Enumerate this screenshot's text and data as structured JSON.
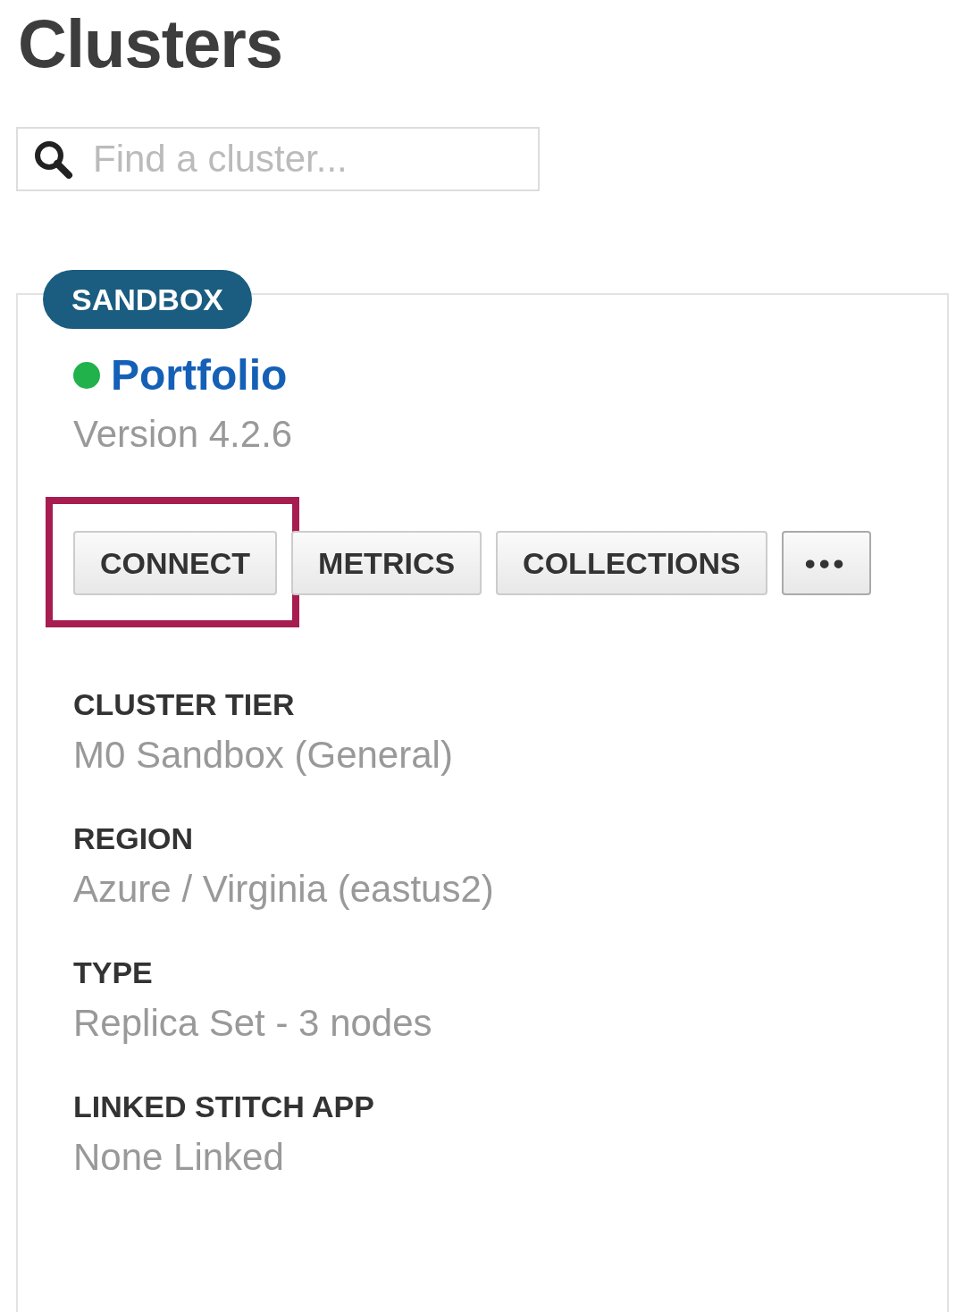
{
  "title": "Clusters",
  "search": {
    "placeholder": "Find a cluster..."
  },
  "cluster": {
    "badge": "SANDBOX",
    "online": true,
    "name": "Portfolio",
    "version": "Version 4.2.6",
    "buttons": [
      {
        "kind": "text",
        "label": "CONNECT",
        "highlighted": true
      },
      {
        "kind": "text",
        "label": "METRICS",
        "highlighted": false
      },
      {
        "kind": "text",
        "label": "COLLECTIONS",
        "highlighted": false
      },
      {
        "kind": "more",
        "label": "•••",
        "highlighted": false
      }
    ],
    "details": [
      {
        "label": "CLUSTER TIER",
        "value": "M0 Sandbox (General)"
      },
      {
        "label": "REGION",
        "value": "Azure / Virginia (eastus2)"
      },
      {
        "label": "TYPE",
        "value": "Replica Set - 3 nodes"
      },
      {
        "label": "LINKED STITCH APP",
        "value": "None Linked"
      }
    ]
  }
}
